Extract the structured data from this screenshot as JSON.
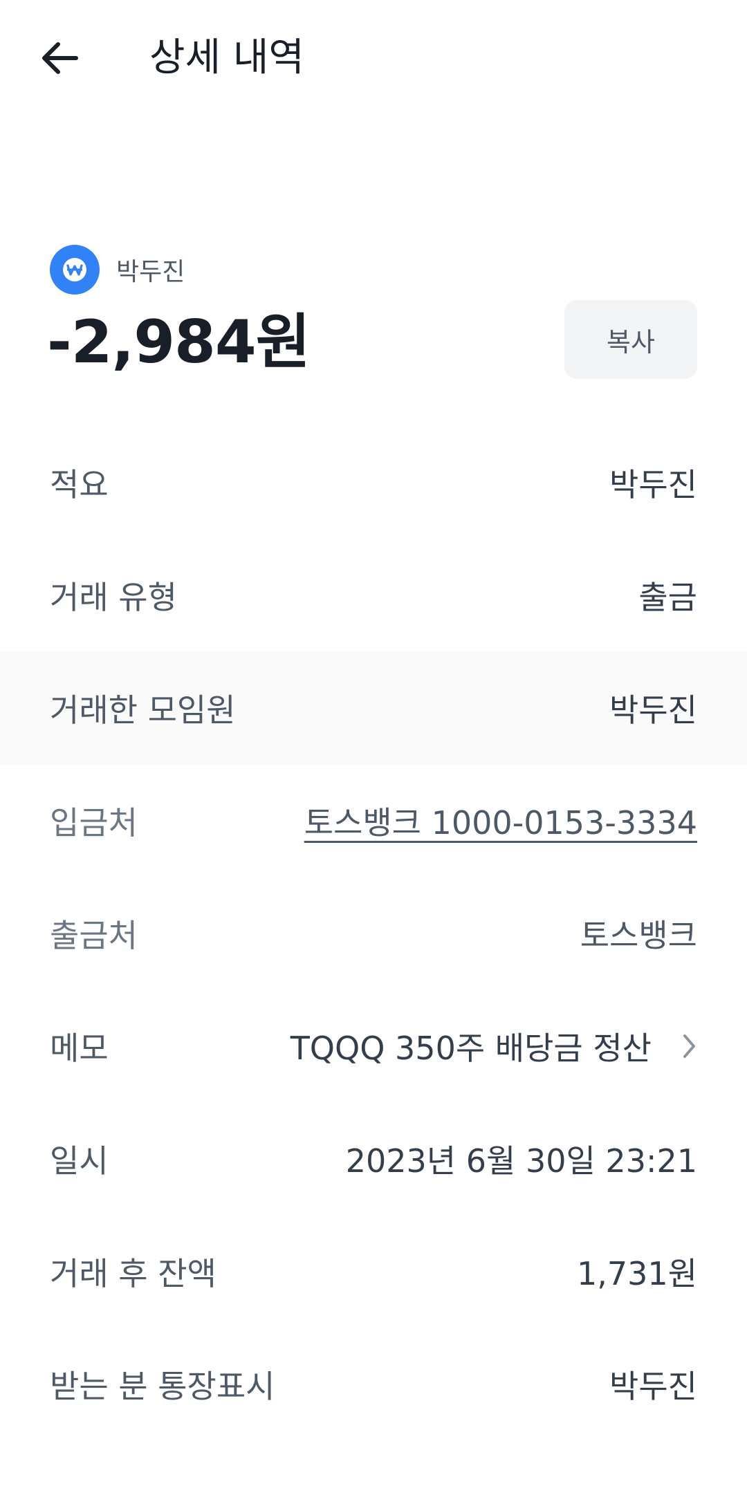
{
  "header": {
    "title": "상세 내역"
  },
  "account": {
    "name": "박두진",
    "icon": "won-icon",
    "amount": "-2,984원",
    "copy_label": "복사",
    "accent_color": "#3182f6"
  },
  "details": [
    {
      "label": "적요",
      "value": "박두진"
    },
    {
      "label": "거래 유형",
      "value": "출금"
    },
    {
      "label": "거래한 모임원",
      "value": "박두진"
    },
    {
      "label": "입금처",
      "value": "토스뱅크 1000-0153-3334"
    },
    {
      "label": "출금처",
      "value": "토스뱅크"
    },
    {
      "label": "메모",
      "value": "TQQQ 350주 배당금 정산"
    },
    {
      "label": "일시",
      "value": "2023년 6월 30일 23:21"
    },
    {
      "label": "거래 후 잔액",
      "value": "1,731원"
    },
    {
      "label": "받는 분 통장표시",
      "value": "박두진"
    }
  ]
}
